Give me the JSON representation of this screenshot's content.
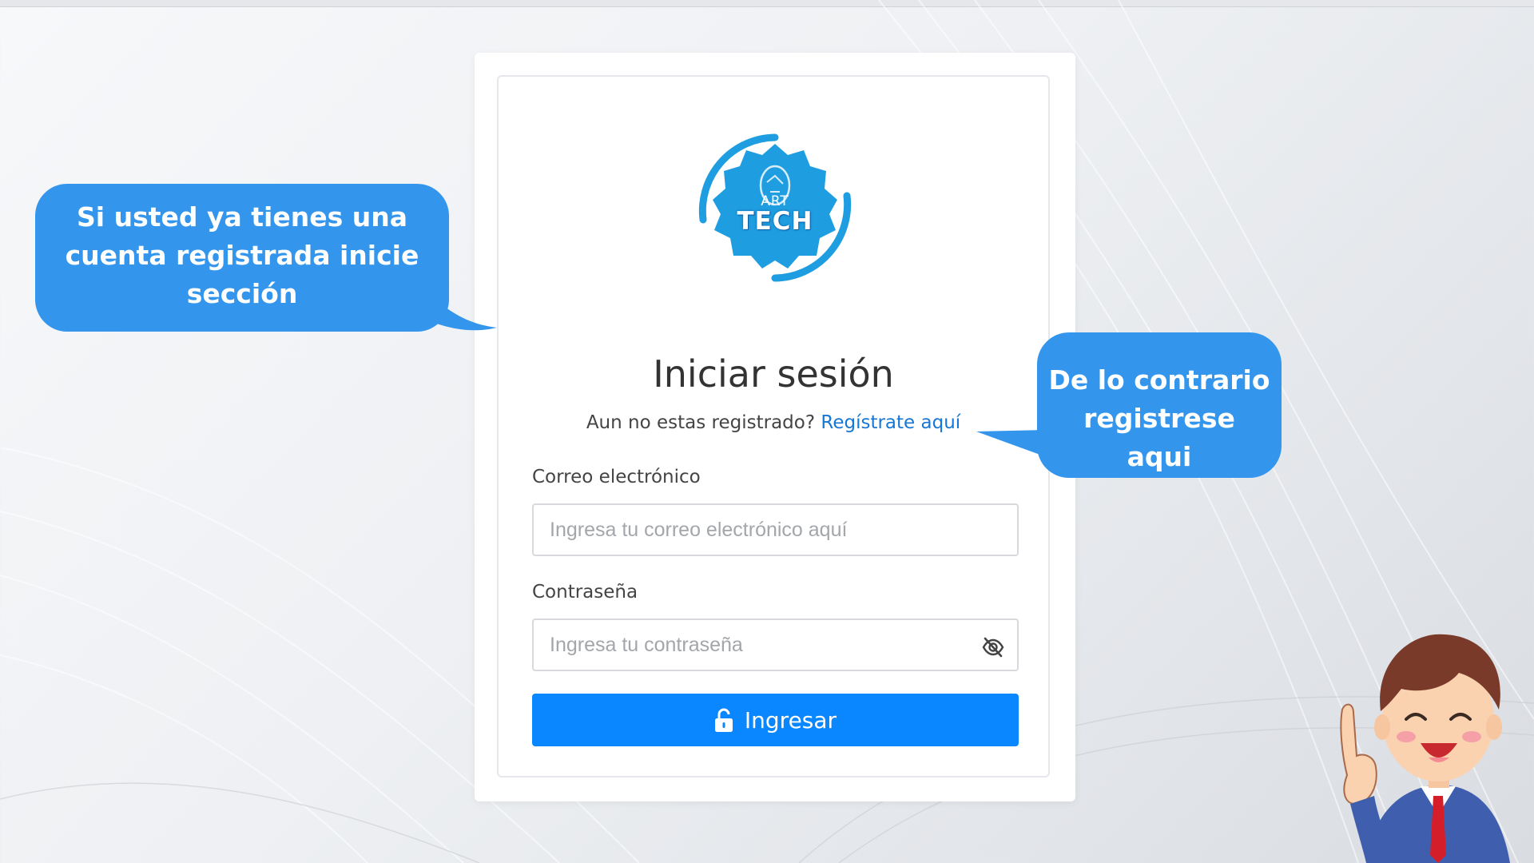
{
  "login": {
    "logo_small_text": "ART",
    "logo_big_text": "TECH",
    "title": "Iniciar sesión",
    "register_prompt": "Aun no estas registrado?",
    "register_link": "Regístrate aquí",
    "email_label": "Correo electrónico",
    "email_placeholder": "Ingresa tu correo electrónico aquí",
    "password_label": "Contraseña",
    "password_placeholder": "Ingresa tu contraseña",
    "submit_label": "Ingresar"
  },
  "callouts": {
    "left": {
      "lines": [
        "Si usted ya tienes una",
        "cuenta registrada inicie",
        "sección"
      ]
    },
    "right": {
      "lines": [
        "De lo contrario",
        "registrese aqui"
      ]
    }
  },
  "icons": {
    "password_toggle": "eye-slash-icon",
    "submit": "unlock-icon"
  },
  "colors": {
    "accent": "#0a86ff",
    "link": "#1677d6",
    "bubble": "#3396ec",
    "logo": "#1e9ee0"
  }
}
